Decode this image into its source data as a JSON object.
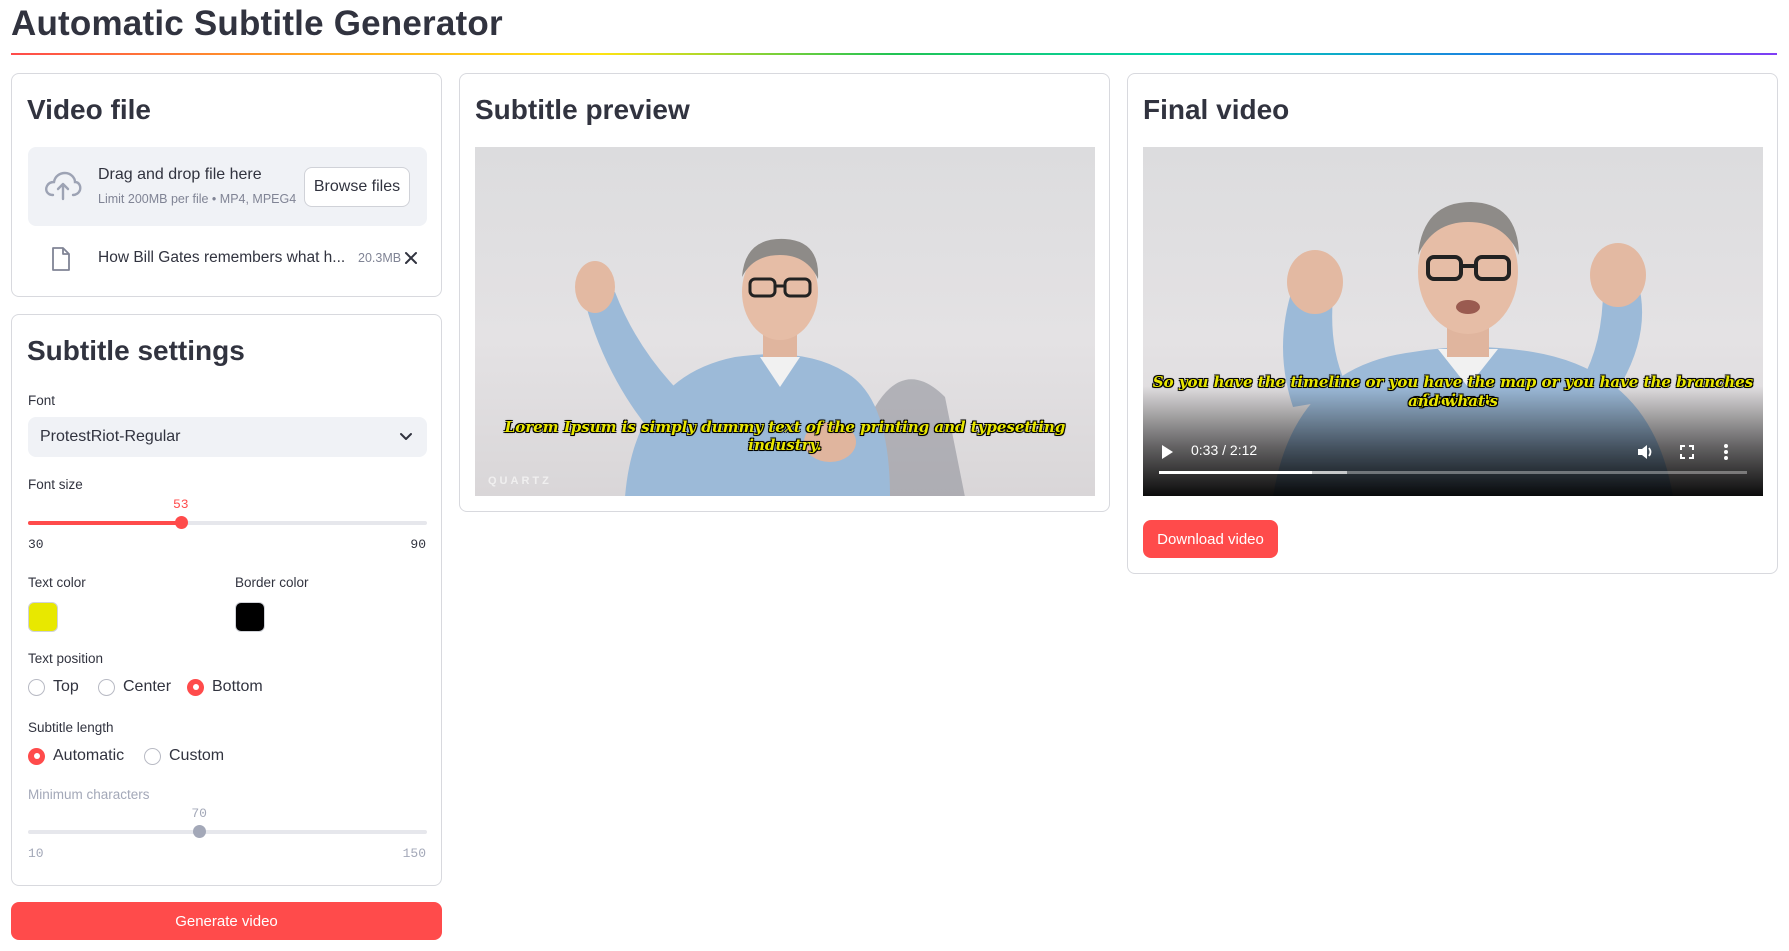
{
  "app": {
    "title": "Automatic Subtitle Generator"
  },
  "video_file": {
    "title": "Video file",
    "dropzone": {
      "main": "Drag and drop file here",
      "sub": "Limit 200MB per file • MP4, MPEG4",
      "browse_label": "Browse files"
    },
    "file": {
      "name": "How Bill Gates remembers what h...",
      "size": "20.3MB"
    }
  },
  "settings": {
    "title": "Subtitle settings",
    "font": {
      "label": "Font",
      "value": "ProtestRiot-Regular"
    },
    "font_size": {
      "label": "Font size",
      "value": "53",
      "min": "30",
      "max": "90",
      "fraction": 0.383
    },
    "text_color": {
      "label": "Text color",
      "color": "#e8e800"
    },
    "border_color": {
      "label": "Border color",
      "color": "#000000"
    },
    "text_position": {
      "label": "Text position",
      "options": [
        "Top",
        "Center",
        "Bottom"
      ],
      "selected": "Bottom"
    },
    "subtitle_length": {
      "label": "Subtitle length",
      "options": [
        "Automatic",
        "Custom"
      ],
      "selected": "Automatic"
    },
    "min_chars": {
      "label": "Minimum characters",
      "value": "70",
      "min": "10",
      "max": "150",
      "fraction": 0.429
    },
    "generate_label": "Generate video"
  },
  "preview": {
    "title": "Subtitle preview",
    "subtitle": "Lorem Ipsum is simply dummy text of the printing and typesetting industry.",
    "watermark": "QUARTZ"
  },
  "final": {
    "title": "Final video",
    "subtitle_line1": "So you have the timeline or you have the map or you have the branches of science",
    "subtitle_line2": "and what's",
    "time": "0:33 / 2:12",
    "progress_fraction": 0.26,
    "download_label": "Download video"
  },
  "colors": {
    "accent": "#ff4b4b",
    "text": "#31333f",
    "muted": "#808495"
  }
}
